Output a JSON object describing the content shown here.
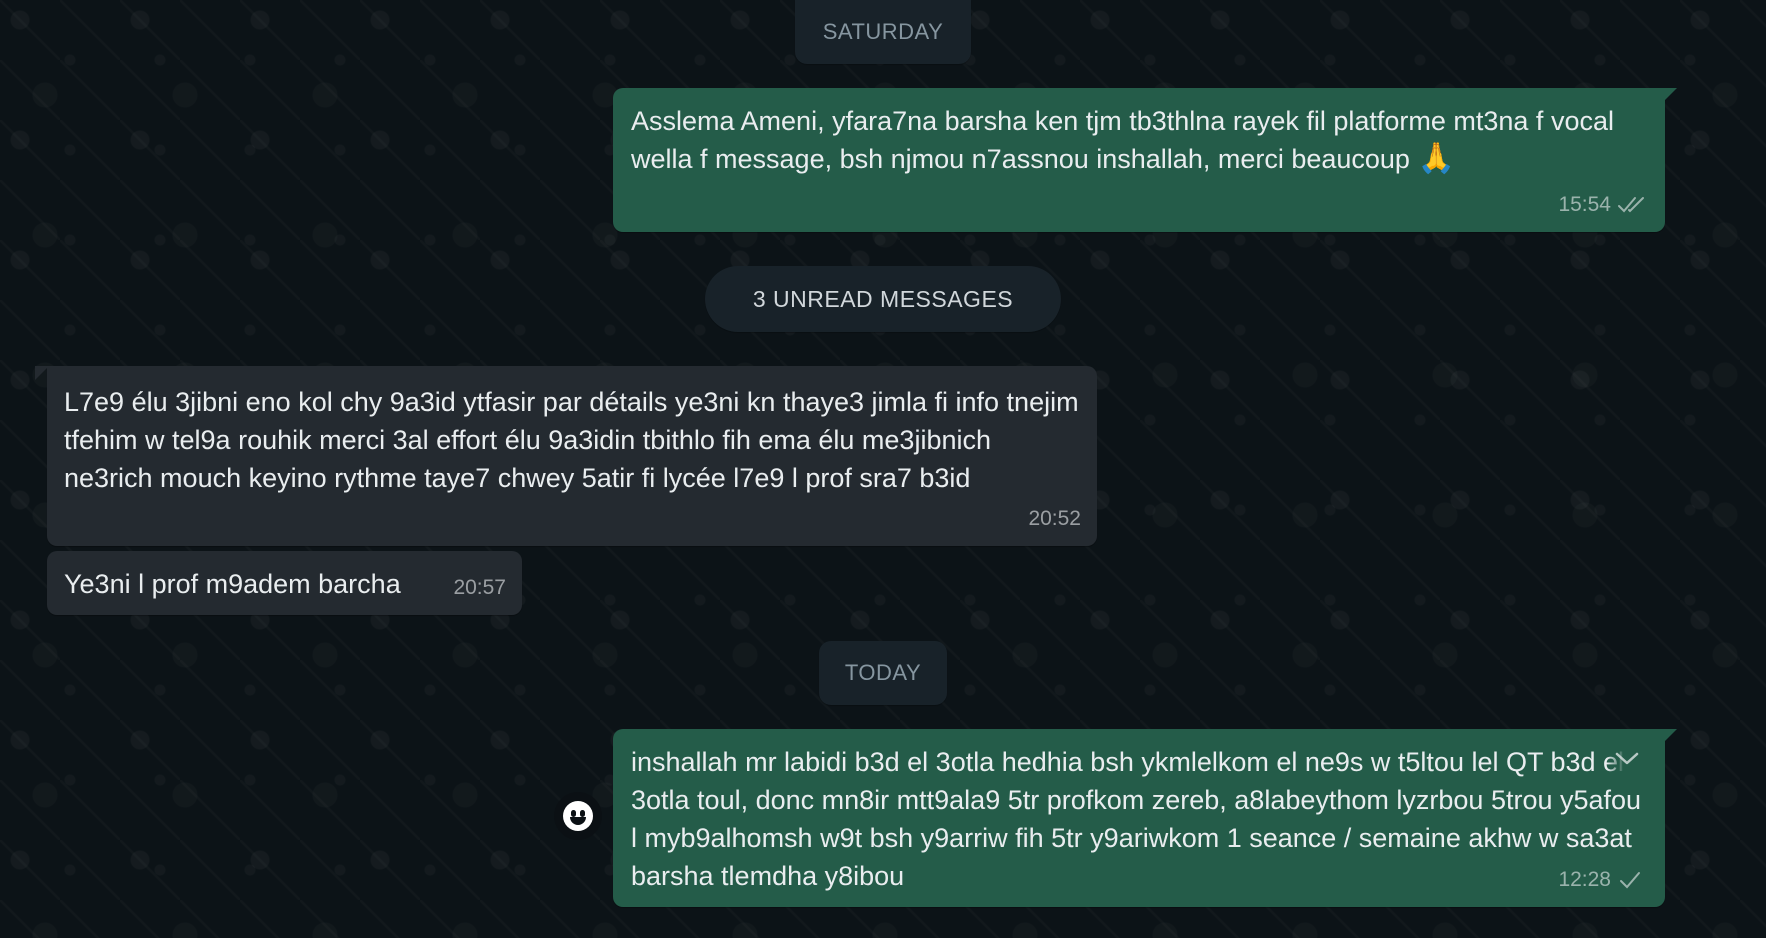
{
  "date_separators": {
    "saturday": "SATURDAY",
    "unread": "3 UNREAD MESSAGES",
    "today": "TODAY"
  },
  "messages": [
    {
      "direction": "outgoing",
      "text": "Asslema Ameni, yfara7na barsha ken tjm tb3thlna rayek fil platforme mt3na f vocal wella f message, bsh njmou n7assnou inshallah, merci beaucoup",
      "emoji": "🙏",
      "time": "15:54",
      "status": "double-check"
    },
    {
      "direction": "incoming",
      "text": "L7e9 élu 3jibni eno kol chy 9a3id ytfasir par détails ye3ni kn thaye3 jimla fi info tnejim tfehim w tel9a rouhik merci 3al effort élu 9a3idin tbithlo fih ema élu me3jibnich ne3rich mouch keyino rythme taye7 chwey 5atir fi lycée l7e9 l prof sra7 b3id",
      "time": "20:52"
    },
    {
      "direction": "incoming",
      "text": "Ye3ni l prof m9adem barcha",
      "time": "20:57"
    },
    {
      "direction": "outgoing",
      "text": "inshallah mr labidi b3d el 3otla hedhia bsh ykmlelkom el ne9s w t5ltou lel QT b3d el 3otla toul, donc mn8ir mtt9ala9 5tr profkom zereb, a8labeythom lyzrbou 5trou y5afou l myb9alhomsh w9t bsh y9arriw fih 5tr y9ariwkom 1 seance / semaine akhw w sa3at barsha tlemdha y8ibou",
      "time": "12:28",
      "status": "single-check"
    }
  ],
  "icons": {
    "double_check": "double-check-icon",
    "single_check": "single-check-icon",
    "chevron": "chevron-down-icon",
    "emoji_reaction": "emoji-reaction-icon"
  },
  "colors": {
    "background": "#0b141a",
    "outgoing_bubble": "#245c49",
    "incoming_bubble": "#242a30",
    "system_pill": "#182229",
    "meta_text": "#8696a0"
  }
}
